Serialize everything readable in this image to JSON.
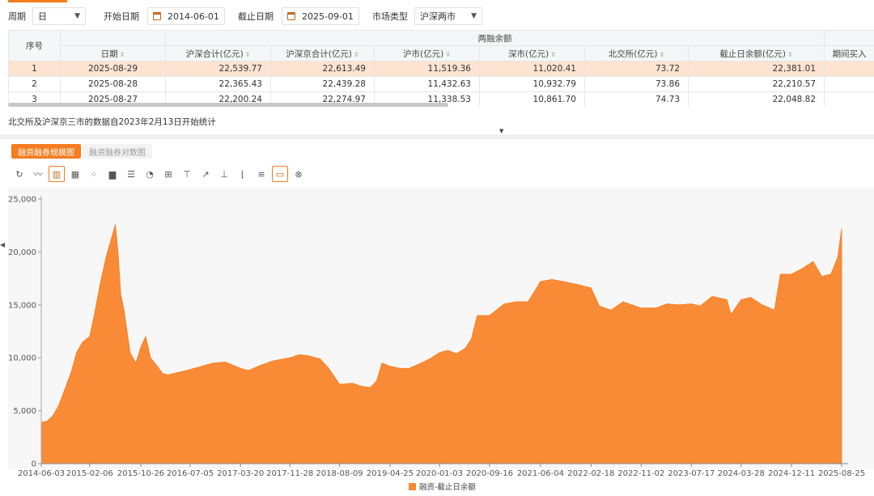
{
  "filters": {
    "period_label": "周期",
    "period_value": "日",
    "start_label": "开始日期",
    "start_value": "2014-06-01",
    "end_label": "截止日期",
    "end_value": "2025-09-01",
    "market_label": "市场类型",
    "market_value": "沪深两市"
  },
  "table": {
    "seq_header": "序号",
    "group_header": "两融余额",
    "columns": [
      "日期",
      "沪深合计(亿元)",
      "沪深京合计(亿元)",
      "沪市(亿元)",
      "深市(亿元)",
      "北交所(亿元)",
      "截止日余额(亿元)",
      "期间买入"
    ],
    "rows": [
      [
        "1",
        "2025-08-29",
        "22,539.77",
        "22,613.49",
        "11,519.36",
        "11,020.41",
        "73.72",
        "22,381.01",
        ""
      ],
      [
        "2",
        "2025-08-28",
        "22,365.43",
        "22,439.28",
        "11,432.63",
        "10,932.79",
        "73.86",
        "22,210.57",
        ""
      ],
      [
        "3",
        "2025-08-27",
        "22,200.24",
        "22,274.97",
        "11,338.53",
        "10,861.70",
        "74.73",
        "22,048.82",
        ""
      ]
    ]
  },
  "note": "北交所及沪深京三市的数据自2023年2月13日开始统计",
  "tabs": [
    "融资融券规模图",
    "融资融券对数图"
  ],
  "toolbar_icons": [
    "restore-icon",
    "line-chart-icon",
    "bar-chart-icon",
    "bar-chart-2-icon",
    "scatter-icon",
    "area-chart-icon",
    "horizontal-bar-icon",
    "pie-icon",
    "boxplot-icon",
    "candlestick-icon",
    "trend-icon",
    "axis-icon",
    "step-icon",
    "stack-icon",
    "data-view-icon",
    "save-image-icon"
  ],
  "colors": {
    "accent": "#f57c1f",
    "series": "#fa8b36"
  },
  "chart_data": {
    "type": "area",
    "title": "",
    "xlabel": "",
    "ylabel": "",
    "ylim": [
      0,
      25000
    ],
    "yticks": [
      "0",
      "5,000",
      "10,000",
      "15,000",
      "20,000",
      "25,000"
    ],
    "xticks": [
      "2014-06-03",
      "2015-02-06",
      "2015-10-26",
      "2016-07-05",
      "2017-03-20",
      "2017-11-28",
      "2018-08-09",
      "2019-04-25",
      "2020-01-03",
      "2020-09-16",
      "2021-06-04",
      "2022-02-18",
      "2022-11-02",
      "2023-07-17",
      "2024-03-28",
      "2024-12-11",
      "2025-08-25"
    ],
    "legend": "bottom-center",
    "grid": false,
    "series": [
      {
        "name": "融资-截止日余额",
        "x": [
          "2014-06-03",
          "2014-07-01",
          "2014-08-01",
          "2014-09-01",
          "2014-10-01",
          "2014-11-01",
          "2014-12-01",
          "2015-01-01",
          "2015-02-06",
          "2015-03-01",
          "2015-04-01",
          "2015-05-01",
          "2015-06-01",
          "2015-06-18",
          "2015-07-01",
          "2015-07-15",
          "2015-08-01",
          "2015-09-01",
          "2015-10-01",
          "2015-10-26",
          "2015-11-20",
          "2015-12-15",
          "2016-01-15",
          "2016-02-15",
          "2016-03-15",
          "2016-05-01",
          "2016-07-05",
          "2016-09-01",
          "2016-11-01",
          "2017-01-01",
          "2017-03-20",
          "2017-05-01",
          "2017-07-01",
          "2017-09-01",
          "2017-11-28",
          "2018-01-15",
          "2018-03-01",
          "2018-05-01",
          "2018-06-15",
          "2018-08-09",
          "2018-10-15",
          "2018-12-01",
          "2019-01-15",
          "2019-02-15",
          "2019-03-15",
          "2019-04-25",
          "2019-06-15",
          "2019-08-01",
          "2019-10-01",
          "2019-11-15",
          "2020-01-03",
          "2020-02-15",
          "2020-04-01",
          "2020-05-15",
          "2020-06-15",
          "2020-07-15",
          "2020-09-16",
          "2020-12-01",
          "2021-02-01",
          "2021-04-01",
          "2021-06-04",
          "2021-08-01",
          "2021-10-01",
          "2021-12-15",
          "2022-02-18",
          "2022-04-01",
          "2022-06-01",
          "2022-08-01",
          "2022-11-02",
          "2023-01-15",
          "2023-03-15",
          "2023-05-15",
          "2023-07-17",
          "2023-09-01",
          "2023-11-01",
          "2024-01-15",
          "2024-02-05",
          "2024-03-28",
          "2024-05-15",
          "2024-07-15",
          "2024-09-15",
          "2024-10-15",
          "2024-12-11",
          "2025-02-01",
          "2025-04-01",
          "2025-05-15",
          "2025-07-01",
          "2025-08-05",
          "2025-08-25"
        ],
        "values": [
          3900,
          4000,
          4500,
          5500,
          7000,
          8500,
          10500,
          11500,
          12000,
          14000,
          17000,
          19500,
          21500,
          22600,
          20000,
          16000,
          14500,
          10500,
          9500,
          11000,
          12000,
          10000,
          9300,
          8500,
          8400,
          8600,
          8900,
          9200,
          9500,
          9600,
          9000,
          8800,
          9300,
          9700,
          10000,
          10300,
          10200,
          9900,
          9000,
          7500,
          7600,
          7300,
          7200,
          7800,
          9500,
          9200,
          9000,
          9000,
          9500,
          9900,
          10500,
          10700,
          10400,
          10900,
          11800,
          14000,
          14000,
          15100,
          15300,
          15300,
          17200,
          17400,
          17200,
          16900,
          16600,
          14900,
          14500,
          15300,
          14700,
          14700,
          15100,
          15000,
          15100,
          14900,
          15800,
          15500,
          14100,
          15500,
          15700,
          15000,
          14500,
          17900,
          17900,
          18400,
          19100,
          17700,
          17900,
          19500,
          22200
        ]
      }
    ]
  }
}
